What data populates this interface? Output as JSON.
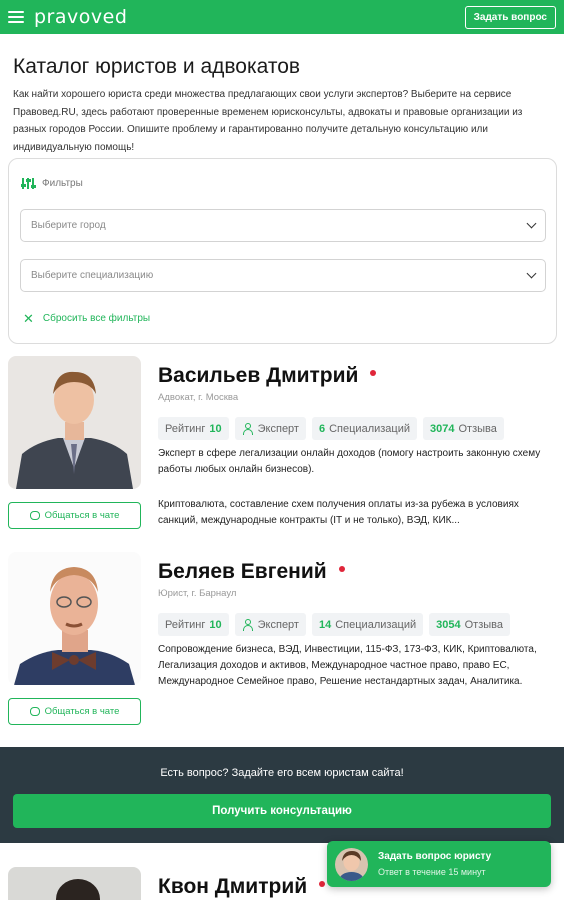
{
  "header": {
    "logo": "pravoved",
    "ask_button": "Задать вопрос"
  },
  "page_title": "Каталог юристов и адвокатов",
  "intro": "Как найти хорошего юриста среди множества предлагающих свои услуги экспертов? Выберите на сервисе Правовед.RU, здесь работают проверенные временем юрисконсульты, адвокаты и правовые организации из разных городов России. Опишите проблему и гарантированно получите детальную консультацию или индивидуальную помощь!",
  "filters": {
    "title": "Фильтры",
    "city_placeholder": "Выберите город",
    "spec_placeholder": "Выберите специализацию",
    "reset": "Сбросить все фильтры"
  },
  "lawyers": [
    {
      "name": "Васильев Дмитрий",
      "role": "Адвокат, г. Москва",
      "rating_label": "Рейтинг",
      "rating": "10",
      "level": "Эксперт",
      "spec_count": "6",
      "spec_label": "Специализаций",
      "reviews": "3074",
      "reviews_label": "Отзыва",
      "desc1": "Эксперт в сфере легализации онлайн доходов (помогу настроить законную схему работы любых онлайн бизнесов).",
      "desc2": "Криптовалюта, составление схем получения оплаты из-за рубежа в условиях санкций, международные контракты (IT и не только), ВЭД, КИК...",
      "chat": "Общаться в чате"
    },
    {
      "name": "Беляев Евгений",
      "role": "Юрист, г. Барнаул",
      "rating_label": "Рейтинг",
      "rating": "10",
      "level": "Эксперт",
      "spec_count": "14",
      "spec_label": "Специализаций",
      "reviews": "3054",
      "reviews_label": "Отзыва",
      "desc1": "Сопровождение бизнеса, ВЭД, Инвестиции, 115-ФЗ, 173-ФЗ, КИК, Криптовалюта, Легализация доходов и активов, Международное частное право, право ЕС, Международное Семейное право, Решение нестандартных задач, Аналитика.",
      "chat": "Общаться в чате"
    },
    {
      "name": "Квон Дмитрий"
    }
  ],
  "cta": {
    "text": "Есть вопрос? Задайте его всем юристам сайта!",
    "button": "Получить консультацию"
  },
  "widget": {
    "title": "Задать вопрос юристу",
    "subtitle": "Ответ в течение 15 минут"
  },
  "colors": {
    "brand_green": "#21b55a",
    "cta_background": "#2c3a42",
    "status_dot": "#e0263a"
  }
}
